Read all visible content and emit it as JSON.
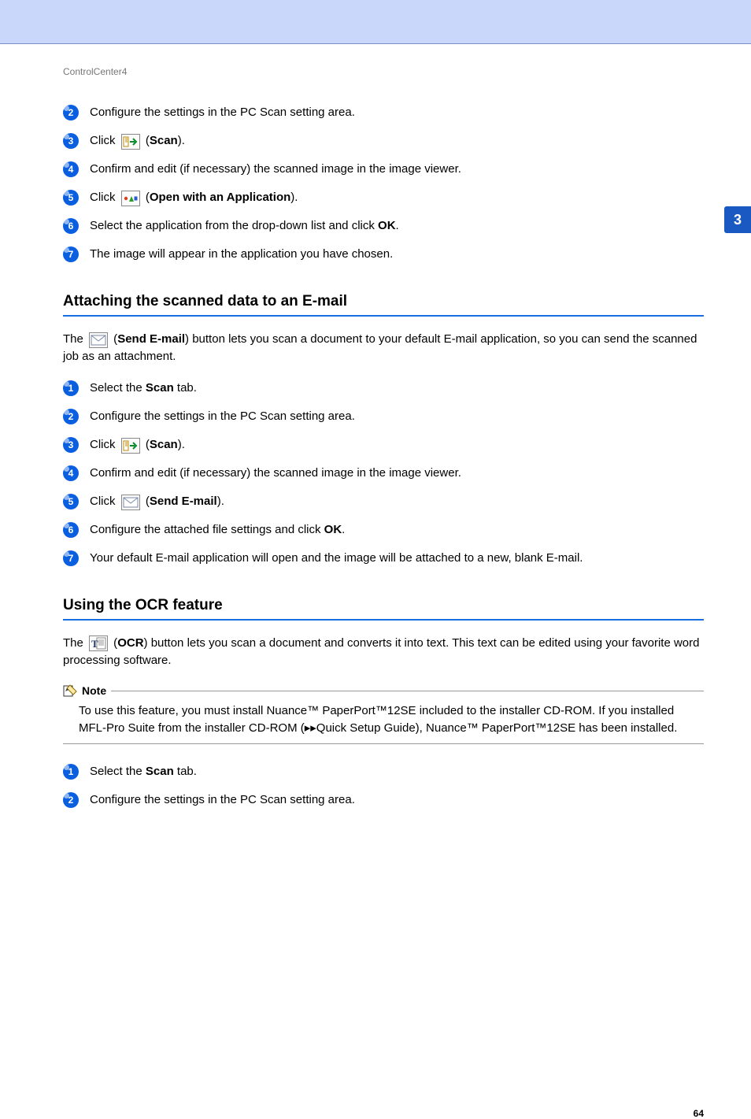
{
  "breadcrumb": "ControlCenter4",
  "sideTab": "3",
  "pageNumber": "64",
  "topSteps": [
    {
      "n": "2",
      "parts": [
        {
          "t": "Configure the settings in the PC Scan setting area."
        }
      ]
    },
    {
      "n": "3",
      "parts": [
        {
          "t": "Click "
        },
        {
          "icon": "scan"
        },
        {
          "t": " ("
        },
        {
          "t": "Scan",
          "b": true
        },
        {
          "t": ")."
        }
      ]
    },
    {
      "n": "4",
      "parts": [
        {
          "t": "Confirm and edit (if necessary) the scanned image in the image viewer."
        }
      ]
    },
    {
      "n": "5",
      "parts": [
        {
          "t": "Click "
        },
        {
          "icon": "open"
        },
        {
          "t": "  ("
        },
        {
          "t": "Open with an Application",
          "b": true
        },
        {
          "t": ")."
        }
      ]
    },
    {
      "n": "6",
      "parts": [
        {
          "t": "Select the application from the drop-down list and click "
        },
        {
          "t": "OK",
          "b": true
        },
        {
          "t": "."
        }
      ]
    },
    {
      "n": "7",
      "parts": [
        {
          "t": "The image will appear in the application you have chosen."
        }
      ]
    }
  ],
  "sectionA": {
    "title": "Attaching the scanned data to an E-mail",
    "intro": [
      {
        "t": "The "
      },
      {
        "icon": "email"
      },
      {
        "t": " ("
      },
      {
        "t": "Send E-mail",
        "b": true
      },
      {
        "t": ") button lets you scan a document to your default E-mail application, so you can send the scanned job as an attachment."
      }
    ],
    "steps": [
      {
        "n": "1",
        "parts": [
          {
            "t": "Select the "
          },
          {
            "t": "Scan",
            "b": true
          },
          {
            "t": " tab."
          }
        ]
      },
      {
        "n": "2",
        "parts": [
          {
            "t": "Configure the settings in the PC Scan setting area."
          }
        ]
      },
      {
        "n": "3",
        "parts": [
          {
            "t": "Click "
          },
          {
            "icon": "scan"
          },
          {
            "t": " ("
          },
          {
            "t": "Scan",
            "b": true
          },
          {
            "t": ")."
          }
        ]
      },
      {
        "n": "4",
        "parts": [
          {
            "t": "Confirm and edit (if necessary) the scanned image in the image viewer."
          }
        ]
      },
      {
        "n": "5",
        "parts": [
          {
            "t": "Click "
          },
          {
            "icon": "email"
          },
          {
            "t": "  ("
          },
          {
            "t": "Send E-mail",
            "b": true
          },
          {
            "t": ")."
          }
        ]
      },
      {
        "n": "6",
        "parts": [
          {
            "t": "Configure the attached file settings and click "
          },
          {
            "t": "OK",
            "b": true
          },
          {
            "t": "."
          }
        ]
      },
      {
        "n": "7",
        "parts": [
          {
            "t": "Your default E-mail application will open and the image will be attached to a new, blank E-mail."
          }
        ]
      }
    ]
  },
  "sectionB": {
    "title": "Using the OCR feature",
    "intro": [
      {
        "t": "The "
      },
      {
        "icon": "ocr"
      },
      {
        "t": " ("
      },
      {
        "t": "OCR",
        "b": true
      },
      {
        "t": ") button lets you scan a document and converts it into text. This text can be edited using your favorite word processing software."
      }
    ],
    "noteLabel": "Note",
    "noteBody": "To use this feature, you must install Nuance™ PaperPort™12SE included to the installer CD-ROM. If you installed MFL-Pro Suite from the installer CD-ROM (▸▸Quick Setup Guide), Nuance™ PaperPort™12SE has been installed.",
    "steps": [
      {
        "n": "1",
        "parts": [
          {
            "t": "Select the "
          },
          {
            "t": "Scan",
            "b": true
          },
          {
            "t": " tab."
          }
        ]
      },
      {
        "n": "2",
        "parts": [
          {
            "t": "Configure the settings in the PC Scan setting area."
          }
        ]
      }
    ]
  }
}
